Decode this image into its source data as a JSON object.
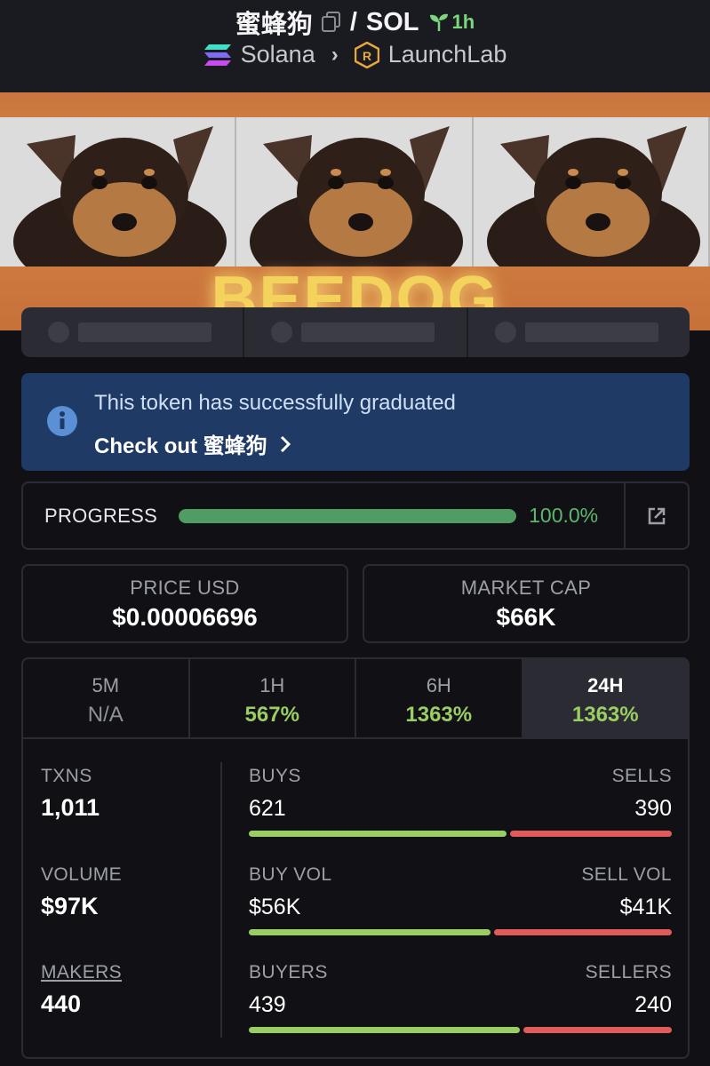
{
  "header": {
    "token": "蜜蜂狗",
    "separator": "/",
    "quote": "SOL",
    "age": "1h",
    "chain": "Solana",
    "launchpad": "LaunchLab",
    "copy_icon": "copy-icon",
    "age_icon": "sprout-icon"
  },
  "banner": {
    "text": "BEEDOG"
  },
  "notice": {
    "message": "This token has successfully graduated",
    "link_text": "Check out 蜜蜂狗"
  },
  "progress": {
    "label": "PROGRESS",
    "value_text": "100.0%",
    "percent": 100
  },
  "stats": {
    "price_label": "PRICE USD",
    "price_value": "$0.00006696",
    "mcap_label": "MARKET CAP",
    "mcap_value": "$66K"
  },
  "periods": [
    {
      "name": "5M",
      "value": "N/A"
    },
    {
      "name": "1H",
      "value": "567%"
    },
    {
      "name": "6H",
      "value": "1363%"
    },
    {
      "name": "24H",
      "value": "1363%"
    }
  ],
  "details": {
    "txns_label": "TXNS",
    "txns_value": "1,011",
    "volume_label": "VOLUME",
    "volume_value": "$97K",
    "makers_label": "MAKERS",
    "makers_value": "440",
    "buys_label": "BUYS",
    "sells_label": "SELLS",
    "buys": "621",
    "sells": "390",
    "buys_n": 621,
    "sells_n": 390,
    "buyvol_label": "BUY VOL",
    "sellvol_label": "SELL VOL",
    "buyvol": "$56K",
    "sellvol": "$41K",
    "buyvol_n": 56,
    "sellvol_n": 41,
    "buyers_label": "BUYERS",
    "sellers_label": "SELLERS",
    "buyers": "439",
    "sellers": "240",
    "buyers_n": 439,
    "sellers_n": 240
  },
  "colors": {
    "green": "#9acd62",
    "red": "#e25a5a",
    "progress": "#4f9d63",
    "notice_bg": "#1f3a64"
  }
}
